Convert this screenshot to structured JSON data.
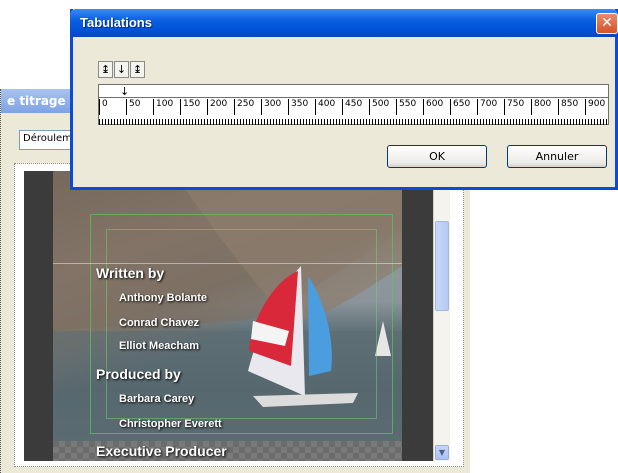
{
  "background_window": {
    "title": "e titrage",
    "combo_value": "Déroulement",
    "credits": [
      {
        "text": "Written by",
        "kind": "heading"
      },
      {
        "text": "Anthony Bolante",
        "kind": "name"
      },
      {
        "text": "Conrad Chavez",
        "kind": "name"
      },
      {
        "text": "Elliot Meacham",
        "kind": "name"
      },
      {
        "text": "Produced by",
        "kind": "heading"
      },
      {
        "text": "Barbara Carey",
        "kind": "name"
      },
      {
        "text": "Christopher Everett",
        "kind": "name"
      },
      {
        "text": "Executive Producer",
        "kind": "heading"
      }
    ],
    "scroll_down_icon": "chevron-down-icon"
  },
  "dialog": {
    "title": "Tabulations",
    "close_glyph": "✕",
    "tab_buttons": [
      {
        "glyph": "↨",
        "icon": "tab-left-icon"
      },
      {
        "glyph": "↓",
        "icon": "tab-center-icon"
      },
      {
        "glyph": "↨",
        "icon": "tab-right-icon"
      }
    ],
    "ruler": {
      "marker_glyph": "↓",
      "labels": [
        "0",
        "50",
        "100",
        "150",
        "200",
        "250",
        "300",
        "350",
        "400",
        "450",
        "500",
        "550",
        "600",
        "650",
        "700",
        "750",
        "800",
        "850",
        "900"
      ]
    },
    "ok_label": "OK",
    "cancel_label": "Annuler"
  }
}
